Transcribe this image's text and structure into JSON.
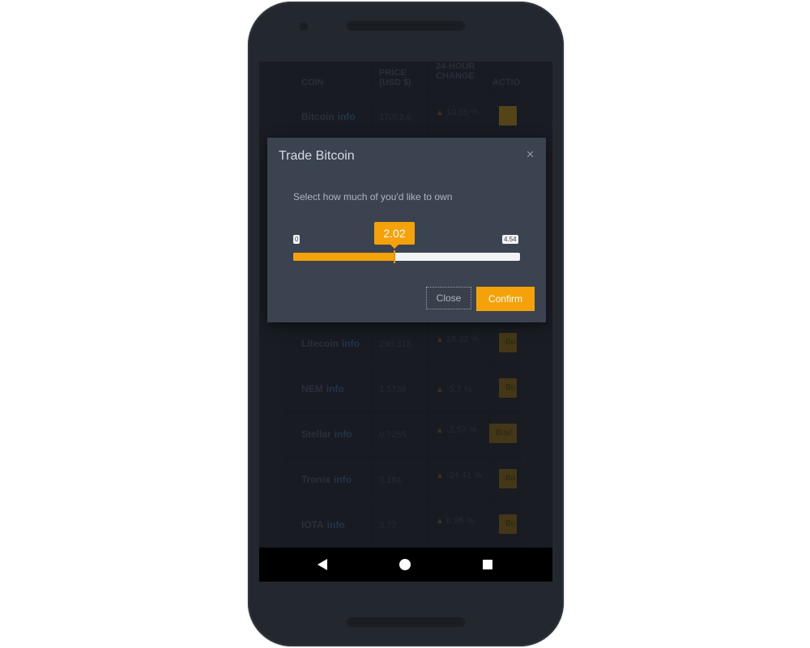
{
  "table": {
    "headers": {
      "coin": "COIN",
      "price": "PRICE (USD $)",
      "change": "24-HOUR CHANGE",
      "action": "ACTIO"
    },
    "rows": [
      {
        "coin": "Bitcoin",
        "info": "info",
        "price": "17053.6",
        "change": "10.05 %",
        "action": ""
      },
      {
        "coin": "Litecoin",
        "info": "info",
        "price": "290.318",
        "change": "18.32 %",
        "action": "Bu"
      },
      {
        "coin": "NEM",
        "info": "info",
        "price": "1.5736",
        "change": "-5.7 %",
        "action": "Bu"
      },
      {
        "coin": "Stellar",
        "info": "info",
        "price": "0.7255",
        "change": "-2.57 %",
        "action": "Buy/"
      },
      {
        "coin": "Tronix",
        "info": "info",
        "price": "0.184",
        "change": "-24.41 %",
        "action": "Bu"
      },
      {
        "coin": "IOTA",
        "info": "info",
        "price": "3.77",
        "change": "8.96 %",
        "action": "Bu"
      }
    ],
    "trend_icon": "chart-trend-icon"
  },
  "modal": {
    "title": "Trade Bitcoin",
    "close_icon": "close-icon",
    "prompt": "Select how much of you'd like to own",
    "slider": {
      "min_label": "0",
      "max_label": "4.54",
      "value_label": "2.02",
      "value": 2.02,
      "min": 0,
      "max": 4.54
    },
    "close_label": "Close",
    "confirm_label": "Confirm"
  },
  "navbar": {
    "back_icon": "back-icon",
    "home_icon": "home-icon",
    "recent_icon": "recent-apps-icon"
  },
  "colors": {
    "accent": "#f5a20a",
    "modal_bg": "#3b4250",
    "screen_bg": "#1e2228"
  }
}
